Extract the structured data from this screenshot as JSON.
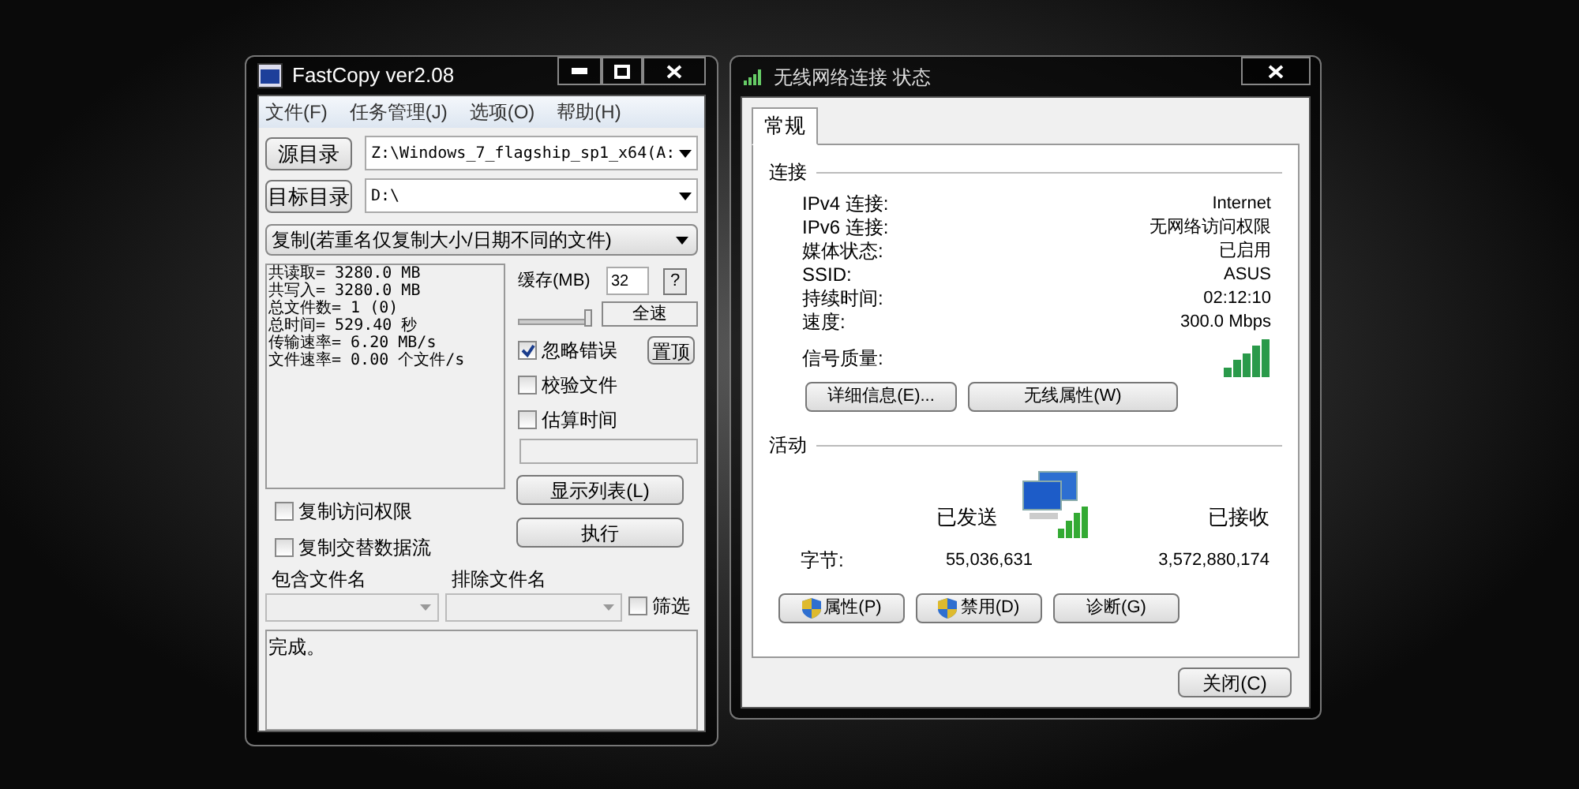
{
  "fastcopy": {
    "title": "FastCopy ver2.08",
    "menu": [
      "文件(F)",
      "任务管理(J)",
      "选项(O)",
      "帮助(H)"
    ],
    "source_button": "源目录",
    "source_path": "Z:\\Windows_7_flagship_sp1_x64(A:",
    "dest_button": "目标目录",
    "dest_path": "D:\\",
    "mode": "复制(若重名仅复制大小/日期不同的文件)",
    "stats": [
      "共读取= 3280.0 MB",
      "共写入= 3280.0 MB",
      "总文件数= 1 (0)",
      "总时间= 529.40 秒",
      "传输速率= 6.20 MB/s",
      "文件速率= 0.00 个文件/s"
    ],
    "buffer_label": "缓存(MB)",
    "buffer_value": "32",
    "help_button": "?",
    "speed_slider": {
      "level": 1
    },
    "speed_label": "全速",
    "options": [
      {
        "label": "忽略错误",
        "checked": true
      },
      {
        "label": "校验文件",
        "checked": false
      },
      {
        "label": "估算时间",
        "checked": false
      }
    ],
    "top_button": "置顶",
    "progress": {
      "level": 0
    },
    "extra_options": [
      {
        "label": "复制访问权限",
        "checked": false
      },
      {
        "label": "复制交替数据流",
        "checked": false
      }
    ],
    "list_button": "显示列表(L)",
    "execute_button": "执行",
    "include_label": "包含文件名",
    "exclude_label": "排除文件名",
    "filter": {
      "label": "筛选",
      "checked": false
    },
    "log": "完成。"
  },
  "network": {
    "title": "无线网络连接 状态",
    "tabs": [
      {
        "label": "常规",
        "selected": true
      }
    ],
    "connection_heading": "连接",
    "fields": [
      {
        "label": "IPv4 连接:",
        "value": "Internet"
      },
      {
        "label": "IPv6 连接:",
        "value": "无网络访问权限"
      },
      {
        "label": "媒体状态:",
        "value": "已启用"
      },
      {
        "label": "SSID:",
        "value": "ASUS"
      },
      {
        "label": "持续时间:",
        "value": "02:12:10"
      },
      {
        "label": "速度:",
        "value": "300.0 Mbps"
      }
    ],
    "signal_label": "信号质量:",
    "buttons": [
      "详细信息(E)...",
      "无线属性(W)"
    ],
    "activity_heading": "活动",
    "sent_label": "已发送",
    "received_label": "已接收",
    "bytes_label": "字节:",
    "sent_value": "55,036,631",
    "received_value": "3,572,880,174",
    "action_buttons": [
      {
        "label": "属性(P)",
        "kind": "shield"
      },
      {
        "label": "禁用(D)",
        "kind": "shield"
      },
      {
        "label": "诊断(G)",
        "kind": "plain"
      }
    ],
    "close_button": "关闭(C)"
  }
}
